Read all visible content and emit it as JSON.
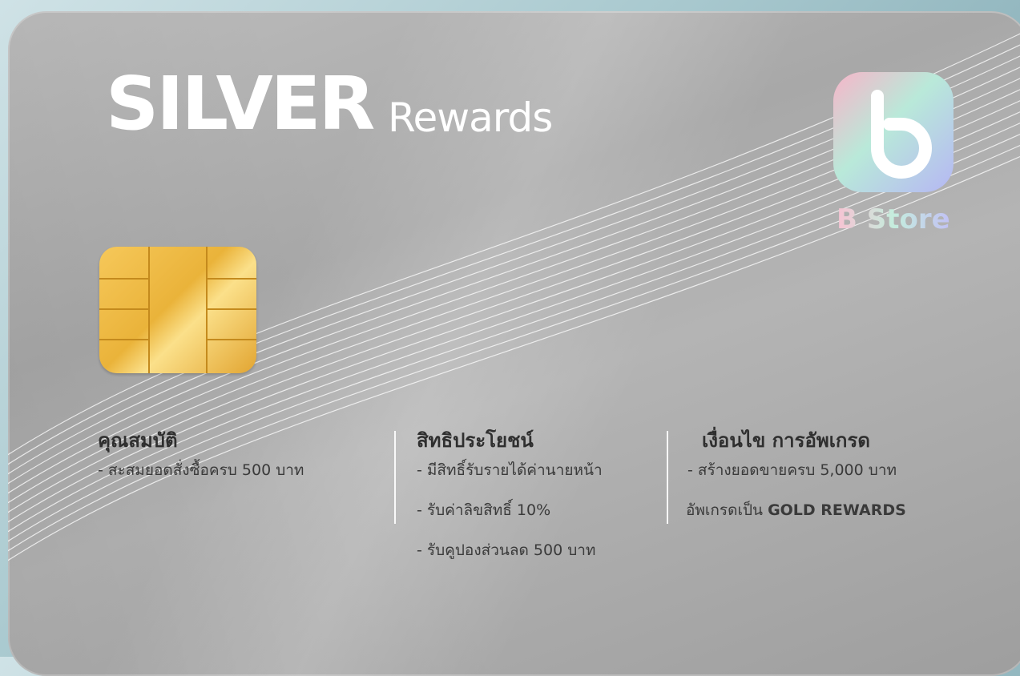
{
  "title": {
    "main": "SILVER",
    "sub": "Rewards"
  },
  "brand": {
    "name": "B Store",
    "icon": "b-logo-icon"
  },
  "colors": {
    "card": "#b0b0b0",
    "chip": "#efb83f",
    "text": "#333333"
  },
  "qualifications": {
    "heading": "คุณสมบัติ",
    "items": [
      "- สะสมยอดสั่งซื้อครบ 500 บาท"
    ]
  },
  "benefits": {
    "heading": "สิทธิประโยชน์",
    "items": [
      "- มีสิทธิ์รับรายได้ค่านายหน้า",
      "- รับค่าลิขสิทธิ์ 10%",
      "- รับคูปองส่วนลด 500 บาท"
    ]
  },
  "upgrade": {
    "heading": "เงื่อนไข การอัพเกรด",
    "items": [
      "- สร้างยอดขายครบ 5,000 บาท"
    ],
    "upgrade_prefix": "อัพเกรดเป็น",
    "upgrade_target": "GOLD REWARDS"
  }
}
